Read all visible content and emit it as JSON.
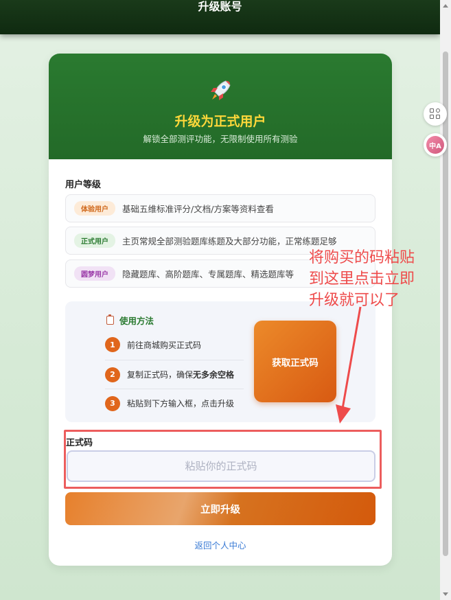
{
  "topbar": {
    "title": "升级账号"
  },
  "hero": {
    "icon": "rocket-icon",
    "title": "升级为正式用户",
    "subtitle": "解锁全部测评功能，无限制使用所有测验"
  },
  "levels": {
    "heading": "用户等级",
    "items": [
      {
        "badge": "体验用户",
        "desc": "基础五维标准评分/文档/方案等资料查看",
        "badge_bg": "#fdebd8",
        "badge_color": "#d0691c"
      },
      {
        "badge": "正式用户",
        "desc": "主页常规全部测验题库练题及大部分功能，正常练题足够",
        "badge_bg": "#e4f3e4",
        "badge_color": "#2a7a30"
      },
      {
        "badge": "圆梦用户",
        "desc": "隐藏题库、高阶题库、专属题库、精选题库等",
        "badge_bg": "#f1e2f5",
        "badge_color": "#9a3aa8"
      }
    ]
  },
  "howto": {
    "title": "使用方法",
    "steps": [
      {
        "num": "1",
        "text": "前往商城购买正式码"
      },
      {
        "num": "2",
        "text_a": "复制正式码，确保",
        "text_b": "无多余空格"
      },
      {
        "num": "3",
        "text": "粘贴到下方输入框，点击升级"
      }
    ],
    "get_code_label": "获取正式码"
  },
  "form": {
    "code_label": "正式码",
    "code_placeholder": "粘贴你的正式码",
    "code_value": "",
    "upgrade_label": "立即升级",
    "back_label": "返回个人中心"
  },
  "annotation": {
    "text": "将购买的码粘贴\n到这里点击立即\n升级就可以了",
    "color": "#ee4b4b"
  },
  "side_buttons": {
    "apps": "apps-icon",
    "translate": "translate-icon",
    "translate_text": "中A"
  },
  "colors": {
    "accent_green": "#2a7a30",
    "accent_orange": "#e0661c",
    "title_yellow": "#ffd83a",
    "link_blue": "#3a7bd5"
  }
}
